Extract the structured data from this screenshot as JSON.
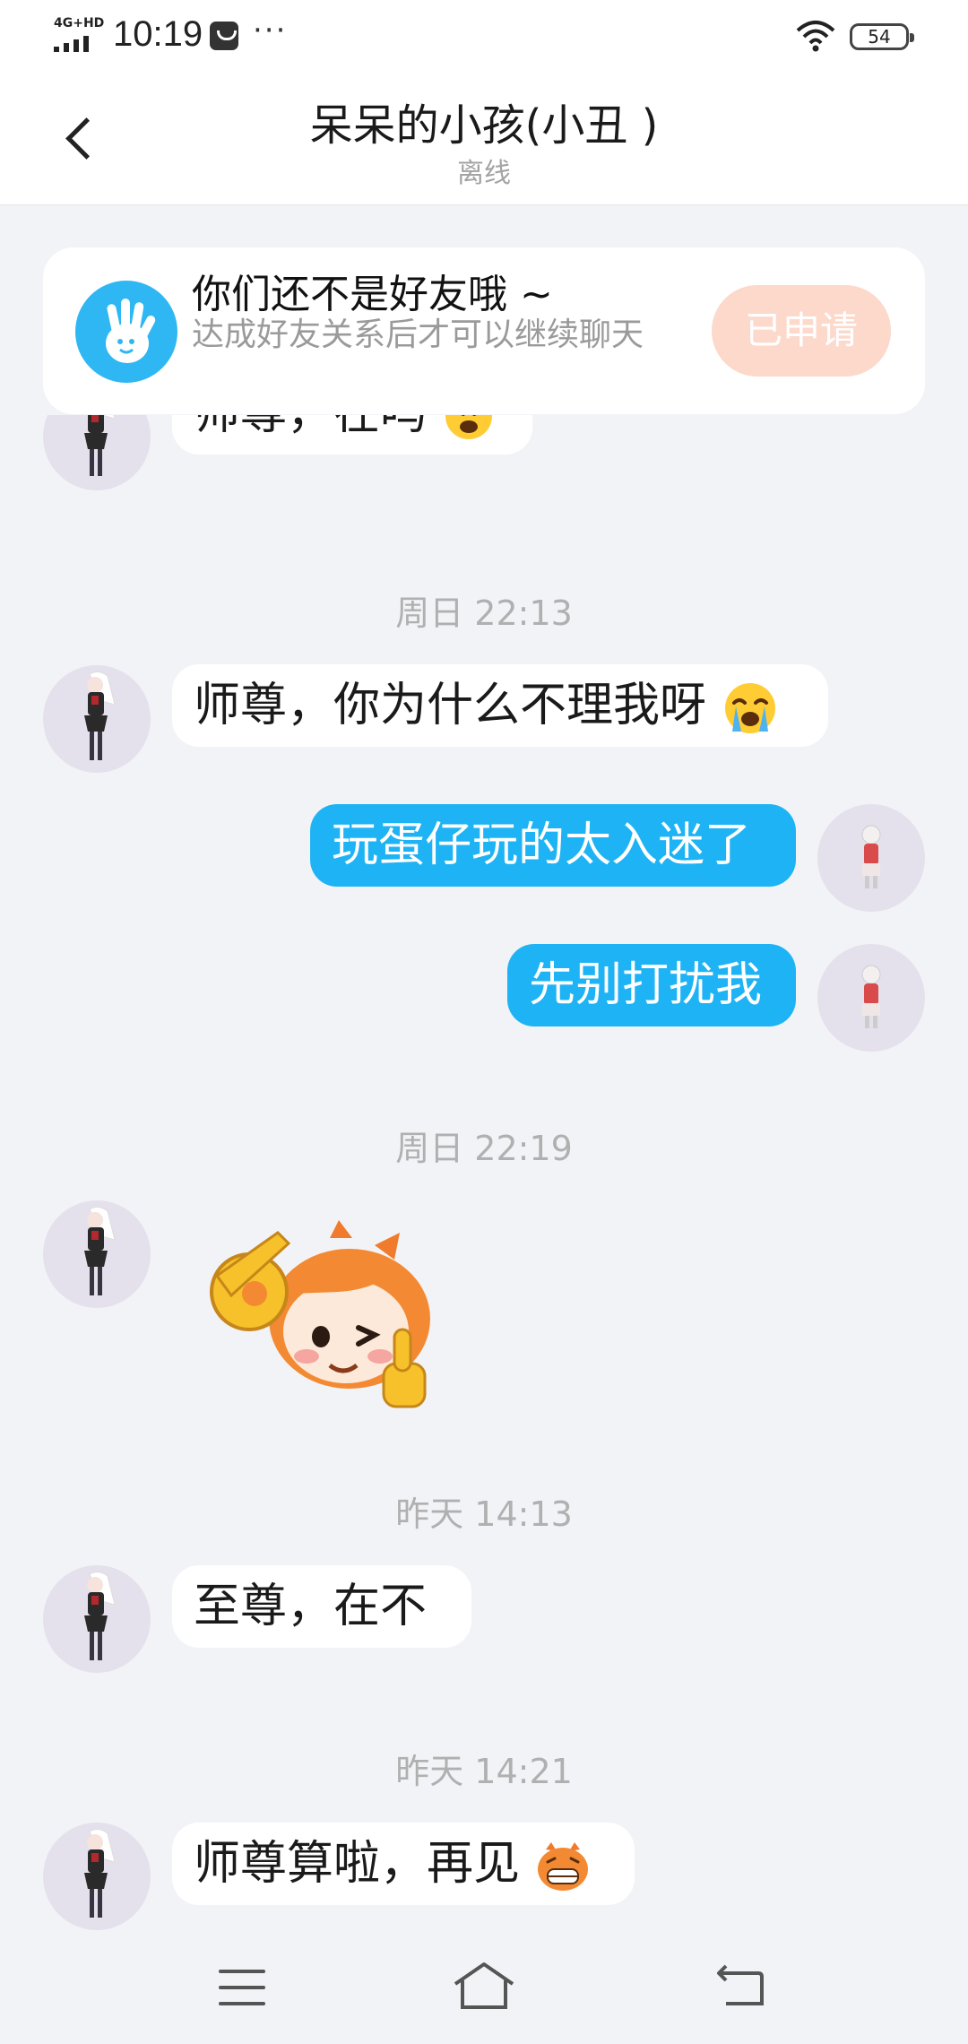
{
  "status_bar": {
    "network": "4G+HD",
    "time": "10:19",
    "more": "···",
    "battery": "54"
  },
  "header": {
    "back_icon": "chevron-left-icon",
    "title": "呆呆的小孩(小丑 )",
    "status": "离线"
  },
  "friend_banner": {
    "icon": "waving-hand-icon",
    "title": "你们还不是好友哦 ~",
    "subtitle": "达成好友关系后才可以继续聊天",
    "button_label": "已申请",
    "colors": {
      "icon_bg": "#2fb7f3",
      "button_bg": "#fcd9cb"
    }
  },
  "messages": {
    "partial_top": {
      "text": "师尊，在吗",
      "emoji": "crying-face-icon"
    },
    "time_1": "周日 22:13",
    "msg_1": {
      "text": "师尊，你为什么不理我呀",
      "emoji": "crying-face-icon"
    },
    "msg_2": {
      "text": "玩蛋仔玩的太入迷了"
    },
    "msg_3": {
      "text": "先别打扰我"
    },
    "time_2": "周日 22:19",
    "sticker": "ok-wink-thumbs-up-sticker-icon",
    "time_3": "昨天 14:13",
    "msg_4": {
      "text": "至尊，在不"
    },
    "time_4": "昨天 14:21",
    "msg_5": {
      "text": "师尊算啦，再见",
      "emoji": "grinning-orange-creature-icon"
    }
  },
  "navbar": {
    "menu_icon": "menu-icon",
    "home_icon": "home-icon",
    "back_icon": "back-icon"
  },
  "colors": {
    "outgoing_bubble": "#1eb3f4",
    "incoming_bubble": "#ffffff",
    "background": "#f2f3f7"
  }
}
